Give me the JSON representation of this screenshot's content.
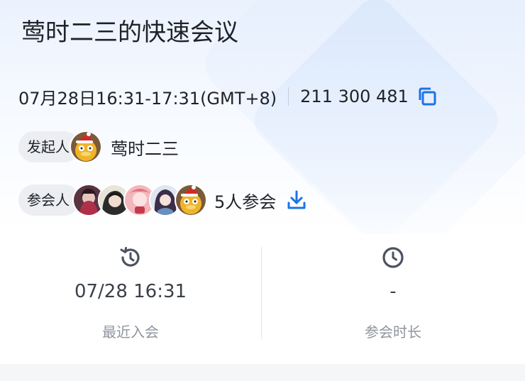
{
  "meeting": {
    "title": "莺时二三的快速会议",
    "time": "07月28日16:31-17:31(GMT+8)",
    "meeting_id": "211 300 481",
    "copy_icon": "copy-icon"
  },
  "host": {
    "label": "发起人",
    "name": "莺时二三"
  },
  "participants": {
    "label": "参会人",
    "count_text": "5人参会",
    "download_icon": "download-icon"
  },
  "stats": {
    "last_join": {
      "value": "07/28 16:31",
      "label": "最近入会",
      "icon": "history-icon"
    },
    "duration": {
      "value": "-",
      "label": "参会时长",
      "icon": "clock-icon"
    }
  },
  "colors": {
    "accent": "#1a73e8",
    "text_primary": "#1f2329",
    "text_secondary": "#8f959e",
    "pill_bg": "#eceef2"
  }
}
